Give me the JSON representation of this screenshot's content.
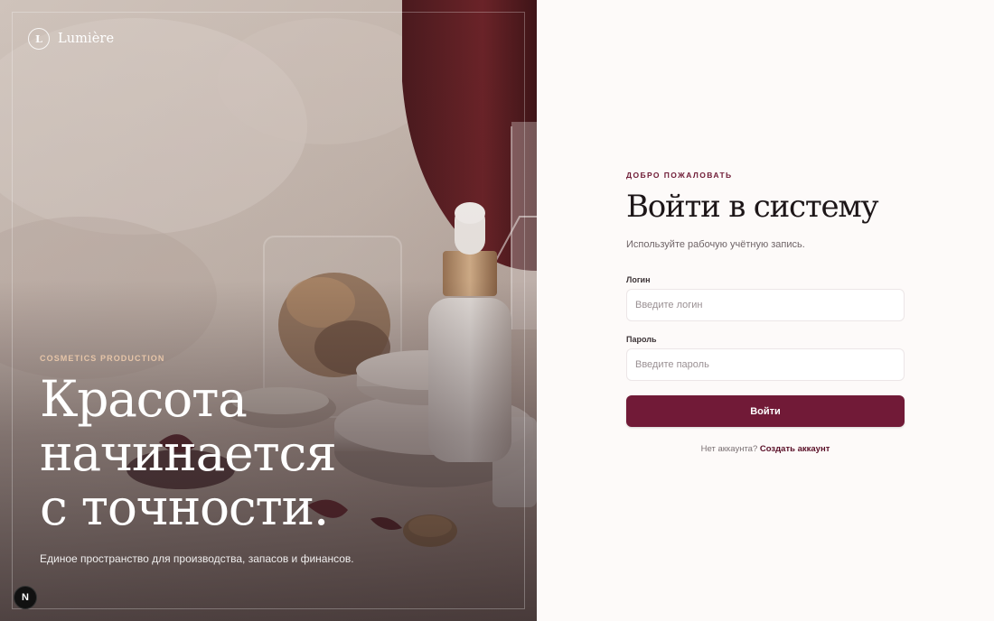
{
  "brand": {
    "logo_letter": "L",
    "name": "Lumière"
  },
  "hero": {
    "eyebrow": "COSMETICS PRODUCTION",
    "title_lines": [
      "Красота",
      "начинается",
      "с точности."
    ],
    "subtitle": "Единое пространство для производства, запасов и финансов."
  },
  "dev_badge": {
    "letter": "N"
  },
  "form": {
    "eyebrow": "ДОБРО ПОЖАЛОВАТЬ",
    "title": "Войти в систему",
    "subtitle": "Используйте рабочую учётную запись.",
    "login_label": "Логин",
    "login_placeholder": "Введите логин",
    "login_value": "",
    "password_label": "Пароль",
    "password_placeholder": "Введите пароль",
    "password_value": "",
    "submit_label": "Войти",
    "signup_prompt": "Нет аккаунта?",
    "signup_link": "Создать аккаунт"
  },
  "colors": {
    "accent": "#711a37",
    "eyebrow_accent": "#6e1a35",
    "hero_eyebrow": "#e6c5a8",
    "background": "#fdfaf9"
  }
}
